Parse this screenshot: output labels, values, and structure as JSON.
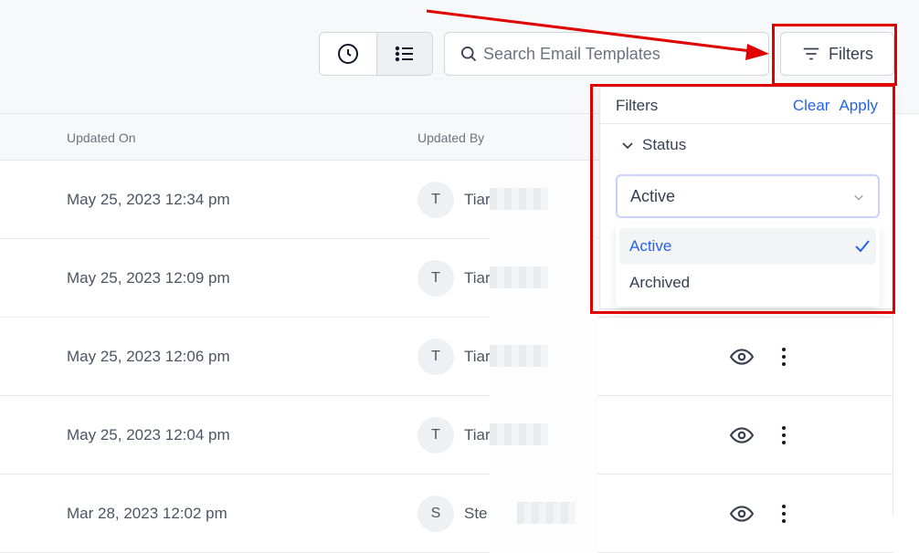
{
  "toolbar": {
    "view_buttons": [
      {
        "name": "history",
        "icon": "clock-icon"
      },
      {
        "name": "list",
        "icon": "list-icon"
      }
    ],
    "search_placeholder": "Search Email Templates",
    "filters_label": "Filters"
  },
  "table": {
    "columns": [
      "Updated On",
      "Updated By"
    ],
    "rows": [
      {
        "updated_on": "May 25, 2023 12:34 pm",
        "avatar": "T",
        "name": "Tiar"
      },
      {
        "updated_on": "May 25, 2023 12:09 pm",
        "avatar": "T",
        "name": "Tiar"
      },
      {
        "updated_on": "May 25, 2023 12:06 pm",
        "avatar": "T",
        "name": "Tiar"
      },
      {
        "updated_on": "May 25, 2023 12:04 pm",
        "avatar": "T",
        "name": "Tiar"
      },
      {
        "updated_on": "Mar 28, 2023 12:02 pm",
        "avatar": "S",
        "name": "Ste"
      }
    ]
  },
  "filter_panel": {
    "title": "Filters",
    "clear_label": "Clear",
    "apply_label": "Apply",
    "section_label": "Status",
    "selected_value": "Active",
    "options": [
      "Active",
      "Archived"
    ]
  },
  "colors": {
    "accent": "#2563eb",
    "highlight": "#e00000"
  }
}
